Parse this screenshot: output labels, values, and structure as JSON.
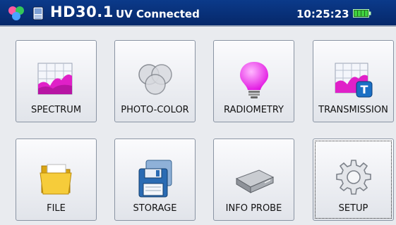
{
  "header": {
    "model": "HD30.1",
    "status": "UV Connected",
    "time": "10:25:23",
    "battery_icon": "battery-icon"
  },
  "menu": {
    "items": [
      {
        "label": "SPECTRUM",
        "icon": "spectrum-chart-icon"
      },
      {
        "label": "PHOTO-COLOR",
        "icon": "color-circles-icon"
      },
      {
        "label": "RADIOMETRY",
        "icon": "light-bulb-icon"
      },
      {
        "label": "TRANSMISSION",
        "icon": "transmission-chart-icon"
      },
      {
        "label": "FILE",
        "icon": "folder-icon"
      },
      {
        "label": "STORAGE",
        "icon": "floppy-disk-icon"
      },
      {
        "label": "INFO PROBE",
        "icon": "probe-device-icon"
      },
      {
        "label": "SETUP",
        "icon": "gear-icon"
      }
    ]
  },
  "colors": {
    "header_bg": "#06286a",
    "battery": "#3fd13f",
    "bulb": "#ff22ff"
  }
}
